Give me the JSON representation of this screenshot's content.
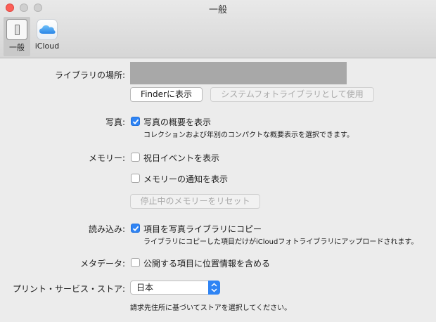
{
  "window": {
    "title": "一般"
  },
  "toolbar": {
    "tabs": [
      {
        "label": "一般",
        "icon": "general-switch-icon",
        "selected": true
      },
      {
        "label": "iCloud",
        "icon": "icloud-icon",
        "selected": false
      }
    ]
  },
  "library": {
    "label": "ライブラリの場所:",
    "finder_button": "Finderに表示",
    "system_library_button": "システムフォトライブラリとして使用"
  },
  "photos": {
    "label": "写真:",
    "summary_checkbox": "写真の概要を表示",
    "summary_checked": true,
    "summary_description": "コレクションおよび年別のコンパクトな概要表示を選択できます。"
  },
  "memories": {
    "label": "メモリー:",
    "holiday_checkbox": "祝日イベントを表示",
    "holiday_checked": false,
    "notify_checkbox": "メモリーの通知を表示",
    "notify_checked": false,
    "reset_button": "停止中のメモリーをリセット"
  },
  "import": {
    "label": "読み込み:",
    "copy_checkbox": "項目を写真ライブラリにコピー",
    "copy_checked": true,
    "copy_description": "ライブラリにコピーした項目だけがiCloudフォトライブラリにアップロードされます。"
  },
  "metadata": {
    "label": "メタデータ:",
    "location_checkbox": "公開する項目に位置情報を含める",
    "location_checked": false
  },
  "print_store": {
    "label": "プリント・サービス・ストア:",
    "selected": "日本",
    "description": "請求先住所に基づいてストアを選択してください。"
  },
  "colors": {
    "accent": "#2f84f4",
    "close": "#fc5f57"
  }
}
